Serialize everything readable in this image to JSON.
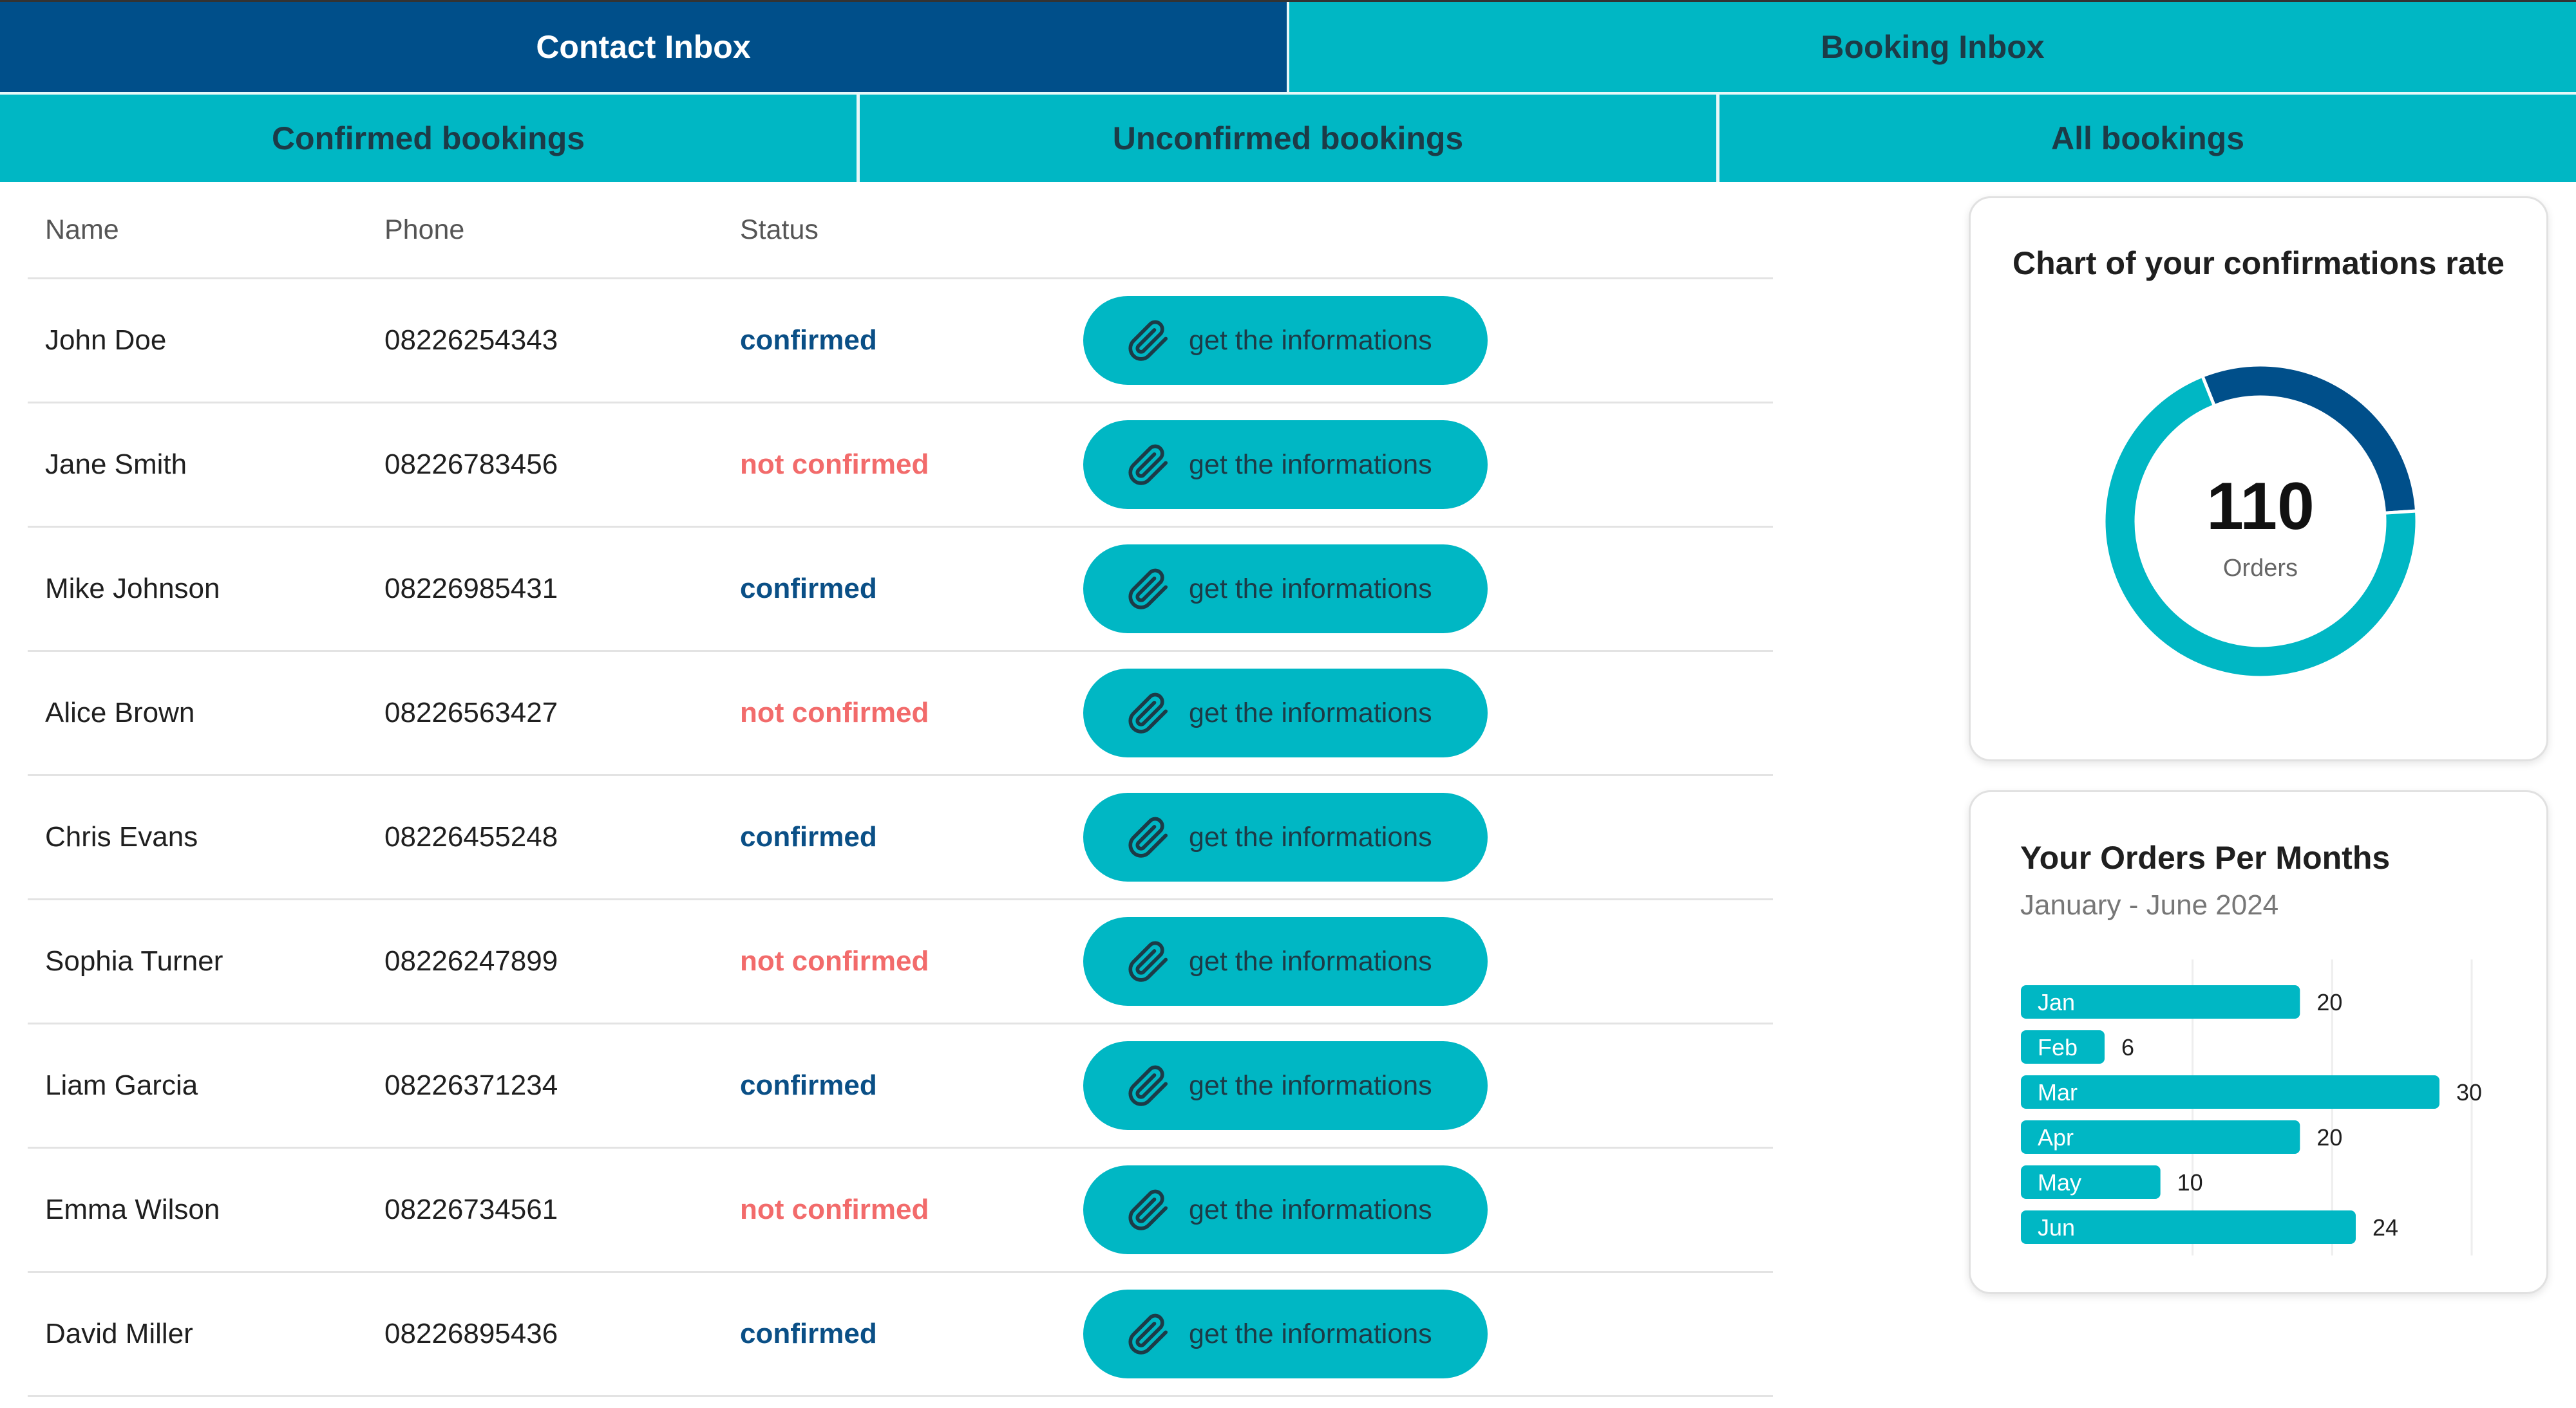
{
  "tabs_top": [
    {
      "label": "Contact Inbox",
      "active": true
    },
    {
      "label": "Booking Inbox",
      "active": false
    }
  ],
  "tabs_sub": [
    {
      "label": "Confirmed bookings"
    },
    {
      "label": "Unconfirmed bookings"
    },
    {
      "label": "All bookings"
    }
  ],
  "table": {
    "headers": {
      "name": "Name",
      "phone": "Phone",
      "status": "Status"
    },
    "action_label": "get the informations",
    "action_icon": "paperclip-icon",
    "rows": [
      {
        "name": "John Doe",
        "phone": "08226254343",
        "status": "confirmed"
      },
      {
        "name": "Jane Smith",
        "phone": "08226783456",
        "status": "not confirmed"
      },
      {
        "name": "Mike Johnson",
        "phone": "08226985431",
        "status": "confirmed"
      },
      {
        "name": "Alice Brown",
        "phone": "08226563427",
        "status": "not confirmed"
      },
      {
        "name": "Chris Evans",
        "phone": "08226455248",
        "status": "confirmed"
      },
      {
        "name": "Sophia Turner",
        "phone": "08226247899",
        "status": "not confirmed"
      },
      {
        "name": "Liam Garcia",
        "phone": "08226371234",
        "status": "confirmed"
      },
      {
        "name": "Emma Wilson",
        "phone": "08226734561",
        "status": "not confirmed"
      },
      {
        "name": "David Miller",
        "phone": "08226895436",
        "status": "confirmed"
      }
    ]
  },
  "colors": {
    "primary_dark": "#004f8a",
    "teal": "#00b7c4",
    "confirmed": "#0a4f86",
    "not_confirmed": "#f26b6b"
  },
  "donut_card": {
    "title": "Chart of your confirmations rate",
    "center_value": "110",
    "center_label": "Orders"
  },
  "bar_card": {
    "title": "Your Orders Per Months",
    "subtitle": "January - June 2024"
  },
  "chart_data": [
    {
      "type": "pie",
      "title": "Chart of your confirmations rate",
      "center_value": "110",
      "center_label": "Orders",
      "slices": [
        {
          "value": 0.3,
          "color": "#004f8a"
        },
        {
          "value": 0.7,
          "color": "#00b7c4"
        }
      ]
    },
    {
      "type": "bar",
      "orientation": "horizontal",
      "title": "Your Orders Per Months",
      "subtitle": "January - June 2024",
      "categories": [
        "Jan",
        "Feb",
        "Mar",
        "Apr",
        "May",
        "Jun"
      ],
      "values": [
        20,
        6,
        30,
        20,
        10,
        24
      ],
      "xlim": [
        0,
        30
      ],
      "bar_color": "#00b7c4",
      "grid": true
    }
  ]
}
